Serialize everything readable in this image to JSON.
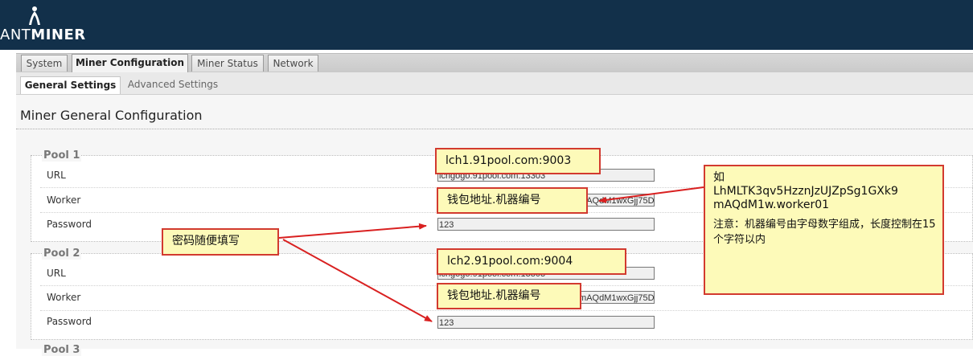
{
  "header": {
    "logo_prefix": "ANT",
    "logo_suffix": "MINER"
  },
  "tabs": [
    {
      "label": "System",
      "active": false
    },
    {
      "label": "Miner Configuration",
      "active": true
    },
    {
      "label": "Miner Status",
      "active": false
    },
    {
      "label": "Network",
      "active": false
    }
  ],
  "subtabs": [
    {
      "label": "General Settings",
      "active": true
    },
    {
      "label": "Advanced Settings",
      "active": false
    }
  ],
  "section_title": "Miner General Configuration",
  "pools": [
    {
      "legend": "Pool 1",
      "url_label": "URL",
      "url_value": "lchgogo.91pool.com:13303",
      "worker_label": "Worker",
      "worker_value": "LhMLTK3qv5HzznJzUJZpSg1GXk9mAQdM1wxGjj75DBXU.1",
      "password_label": "Password",
      "password_value": "123"
    },
    {
      "legend": "Pool 2",
      "url_label": "URL",
      "url_value": "lchgogo.91pool.com:13303",
      "worker_label": "Worker",
      "worker_value": "LhMLTK3qv5HzznJzUJZpSg1GXk9mAQdM1wxGjj75DBXU.1",
      "password_label": "Password",
      "password_value": "123"
    },
    {
      "legend": "Pool 3"
    }
  ],
  "annotations": {
    "pool1_url": "lch1.91pool.com:9003",
    "pool2_url": "lch2.91pool.com:9004",
    "worker1": "钱包地址.机器编号",
    "worker2": "钱包地址.机器编号",
    "password": "密码随便填写",
    "note_lead": "如\nLhMLTK3qv5HzznJzUJZpSg1GXk9\nmAQdM1w.worker01",
    "note_body": "注意：机器编号由字母数字组成，长度控制在15个字符以内"
  },
  "colors": {
    "header_bg": "#12304a",
    "callout_bg": "#fdfab9",
    "callout_border": "#d23a2f",
    "arrow": "#d92020"
  }
}
